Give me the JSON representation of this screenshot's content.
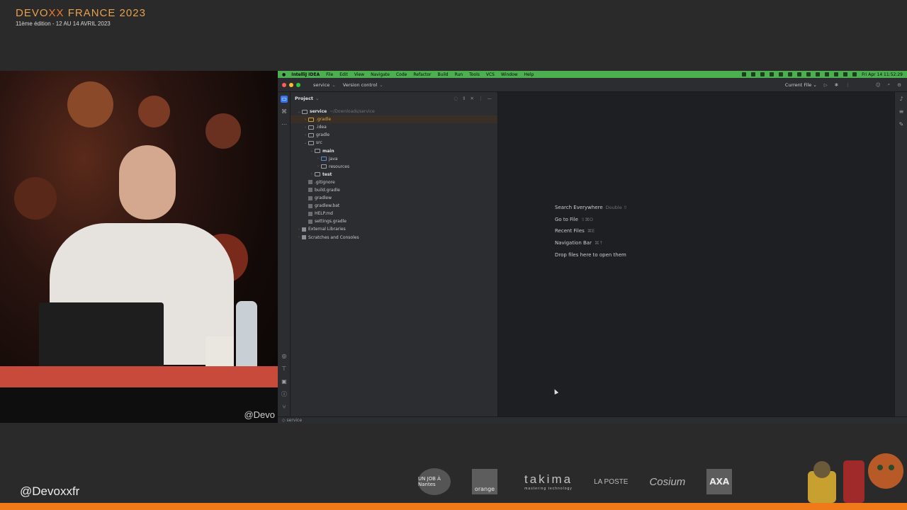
{
  "conference": {
    "title_part1": "DEVO",
    "title_accent": "XX",
    "title_part2": " FRANCE 2023",
    "subtitle": "11ème édition - 12 AU 14 AVRIL 2023",
    "handle": "@Devoxxfr"
  },
  "speaker_overlay": {
    "handle": "@Devo"
  },
  "menubar": {
    "app": "IntelliJ IDEA",
    "items": [
      "File",
      "Edit",
      "View",
      "Navigate",
      "Code",
      "Refactor",
      "Build",
      "Run",
      "Tools",
      "VCS",
      "Window",
      "Help"
    ],
    "clock": "Fri Apr 14  11:52:29"
  },
  "toolbar": {
    "project": "service",
    "vcs": "Version control",
    "run_config": "Current File"
  },
  "project_panel": {
    "title": "Project",
    "tree": [
      {
        "depth": 0,
        "arrow": "⌄",
        "icon": "folder",
        "label": "service",
        "bold": true,
        "path": "~/Downloads/service"
      },
      {
        "depth": 1,
        "arrow": "›",
        "icon": "folder-gr",
        "label": ".gradle",
        "selected": true,
        "gr": true
      },
      {
        "depth": 1,
        "arrow": "›",
        "icon": "folder",
        "label": ".idea"
      },
      {
        "depth": 1,
        "arrow": "›",
        "icon": "folder",
        "label": "gradle"
      },
      {
        "depth": 1,
        "arrow": "⌄",
        "icon": "folder",
        "label": "src"
      },
      {
        "depth": 2,
        "arrow": "⌄",
        "icon": "folder",
        "label": "main",
        "bold": true
      },
      {
        "depth": 3,
        "arrow": "›",
        "icon": "folder-src",
        "label": "java"
      },
      {
        "depth": 3,
        "arrow": "›",
        "icon": "folder-res",
        "label": "resources"
      },
      {
        "depth": 2,
        "arrow": "›",
        "icon": "folder",
        "label": "test",
        "bold": true
      },
      {
        "depth": 1,
        "arrow": "",
        "icon": "file",
        "label": ".gitignore"
      },
      {
        "depth": 1,
        "arrow": "",
        "icon": "file",
        "label": "build.gradle"
      },
      {
        "depth": 1,
        "arrow": "",
        "icon": "file",
        "label": "gradlew"
      },
      {
        "depth": 1,
        "arrow": "",
        "icon": "file",
        "label": "gradlew.bat"
      },
      {
        "depth": 1,
        "arrow": "",
        "icon": "file",
        "label": "HELP.md"
      },
      {
        "depth": 1,
        "arrow": "",
        "icon": "file",
        "label": "settings.gradle"
      },
      {
        "depth": 0,
        "arrow": "›",
        "icon": "lib",
        "label": "External Libraries"
      },
      {
        "depth": 0,
        "arrow": "›",
        "icon": "lib",
        "label": "Scratches and Consoles"
      }
    ]
  },
  "editor_hints": [
    {
      "label": "Search Everywhere",
      "shortcut": "Double ⇧"
    },
    {
      "label": "Go to File",
      "shortcut": "⇧⌘O"
    },
    {
      "label": "Recent Files",
      "shortcut": "⌘E"
    },
    {
      "label": "Navigation Bar",
      "shortcut": "⌘↑"
    },
    {
      "label": "Drop files here to open them",
      "shortcut": ""
    }
  ],
  "statusbar": {
    "breadcrumb": "service"
  },
  "sponsors": {
    "nantes": "UN JOB À Nantes",
    "orange": "orange",
    "takima": "takima",
    "takima_tag": "mastering technology",
    "laposte": "LA POSTE",
    "cosium": "Cosium",
    "axa": "AXA"
  }
}
